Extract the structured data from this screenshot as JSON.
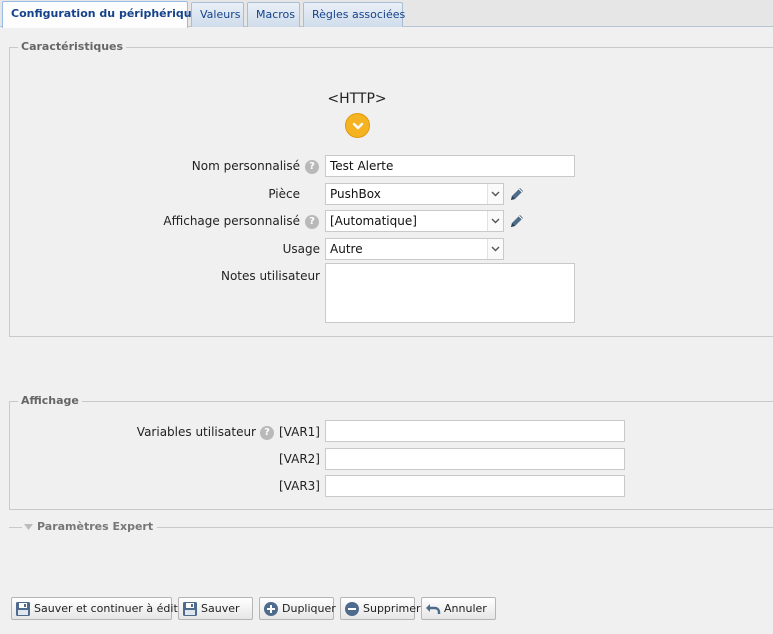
{
  "tabs": [
    {
      "label": "Configuration du périphérique",
      "active": true
    },
    {
      "label": "Valeurs"
    },
    {
      "label": "Macros"
    },
    {
      "label": "Règles associées"
    }
  ],
  "characteristics": {
    "legend": "Caractéristiques",
    "brand": "<HTTP>",
    "name": {
      "label": "Nom personnalisé",
      "value": "Test Alerte"
    },
    "room": {
      "label": "Pièce",
      "value": "PushBox"
    },
    "display": {
      "label": "Affichage personnalisé",
      "value": "[Automatique]"
    },
    "usage": {
      "label": "Usage",
      "value": "Autre"
    },
    "notes": {
      "label": "Notes utilisateur",
      "value": ""
    }
  },
  "affichage": {
    "legend": "Affichage",
    "vars_label": "Variables utilisateur",
    "vars": [
      {
        "label": "[VAR1]",
        "value": ""
      },
      {
        "label": "[VAR2]",
        "value": ""
      },
      {
        "label": "[VAR3]",
        "value": ""
      }
    ]
  },
  "expert": {
    "label": "Paramètres Expert",
    "collapsed": true
  },
  "buttons": {
    "save_continue": "Sauver et continuer à éditer",
    "save": "Sauver",
    "duplicate": "Dupliquer",
    "delete": "Supprimer",
    "cancel": "Annuler"
  },
  "icons": {
    "help": "help-icon",
    "edit": "pencil-icon",
    "collapse": "chevron-down-icon"
  },
  "colors": {
    "accent": "#f5b322",
    "tab_text": "#15428b"
  }
}
